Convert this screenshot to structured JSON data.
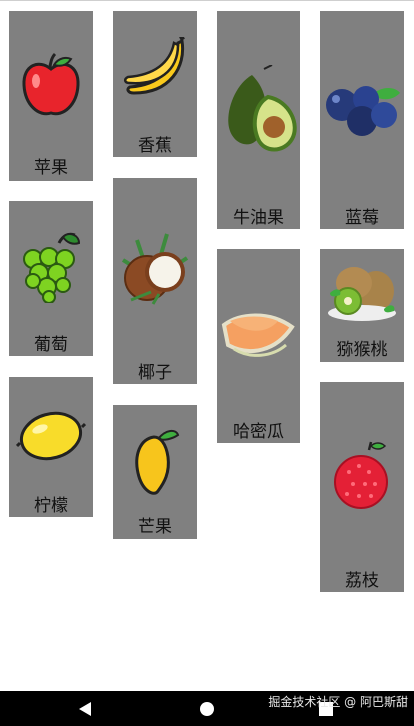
{
  "fruits": [
    {
      "name": "苹果",
      "icon": "apple-icon"
    },
    {
      "name": "葡萄",
      "icon": "grapes-icon"
    },
    {
      "name": "柠檬",
      "icon": "lemon-icon"
    },
    {
      "name": "香蕉",
      "icon": "banana-icon"
    },
    {
      "name": "椰子",
      "icon": "coconut-icon"
    },
    {
      "name": "芒果",
      "icon": "mango-icon"
    },
    {
      "name": "牛油果",
      "icon": "avocado-icon"
    },
    {
      "name": "哈密瓜",
      "icon": "melon-icon"
    },
    {
      "name": "蓝莓",
      "icon": "blueberry-icon"
    },
    {
      "name": "猕猴桃",
      "icon": "kiwi-icon"
    },
    {
      "name": "荔枝",
      "icon": "lychee-icon"
    }
  ],
  "watermark": "掘金技术社区 @ 阿巴斯甜",
  "colors": {
    "card_bg": "#808080",
    "navbar_bg": "#000000"
  },
  "navbar": {
    "back": "back-icon",
    "home": "home-icon",
    "recents": "recents-icon"
  }
}
